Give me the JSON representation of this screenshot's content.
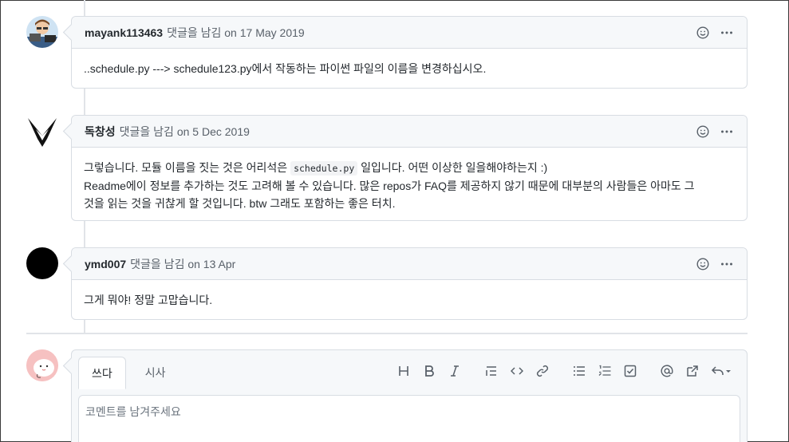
{
  "comments": [
    {
      "author": "mayank113463",
      "meta": "댓글을 남김 on 17 May 2019",
      "body_line1": "..schedule.py ---> schedule123.py에서 작동하는 파이썬 파일의 이름을 변경하십시오."
    },
    {
      "author": "독창성",
      "meta": "댓글을 남김 on 5 Dec 2019",
      "body_line1_a": "그렇습니다. 모듈 이름을 짓는 것은 어리석은 ",
      "body_code": "schedule.py",
      "body_line1_b": " 일입니다. 어떤 이상한 일을해야하는지 :)",
      "body_line2": "Readme에이 정보를 추가하는 것도 고려해 볼 수 있습니다. 많은 repos가 FAQ를 제공하지 않기 때문에 대부분의 사람들은 아마도 그",
      "body_line3": "것을 읽는 것을 귀찮게 할 것입니다. btw 그래도 포함하는 좋은 터치."
    },
    {
      "author": "ymd007",
      "meta": "댓글을 남김 on 13 Apr",
      "body_line1": "그게 뭐야! 정말 고맙습니다."
    }
  ],
  "editor": {
    "tab_write": "쓰다",
    "tab_preview": "시사",
    "placeholder": "코멘트를 남겨주세요"
  },
  "icons": {
    "emoji": "smiley-icon",
    "more": "kebab-horizontal-icon"
  },
  "colors": {
    "border": "#d8dde3",
    "header_bg": "#f6f8fa",
    "muted": "#586069",
    "text": "#24292e"
  }
}
